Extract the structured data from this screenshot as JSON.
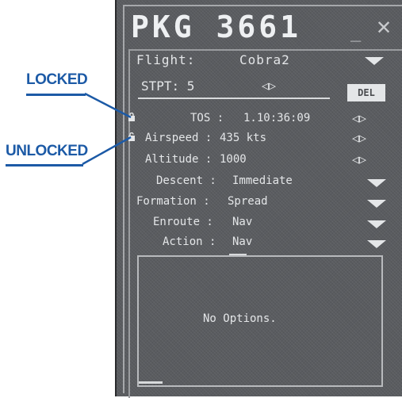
{
  "callouts": {
    "locked": "LOCKED",
    "unlocked": "UNLOCKED"
  },
  "window": {
    "title": "PKG 3661",
    "min": "_",
    "close": "✕"
  },
  "flight": {
    "label": "Flight:",
    "value": "Cobra2"
  },
  "stpt": {
    "label": "STPT: 5",
    "arrows": "◁▷",
    "del": "DEL"
  },
  "fields": [
    {
      "label": "TOS :",
      "value": "1.10:36:09",
      "control": "arrows"
    },
    {
      "label": "Airspeed :",
      "value": "435 kts",
      "control": "arrows"
    },
    {
      "label": "Altitude :",
      "value": "1000",
      "control": "arrows"
    },
    {
      "label": "Descent :",
      "value": "Immediate",
      "control": "dropdown"
    },
    {
      "label": "Formation :",
      "value": "Spread",
      "control": "dropdown"
    },
    {
      "label": "Enroute :",
      "value": "Nav",
      "control": "dropdown"
    },
    {
      "label": "Action :",
      "value": "Nav",
      "control": "dropdown"
    }
  ],
  "options": {
    "empty_text": "No Options."
  },
  "colors": {
    "callout": "#1c5aa6",
    "window_bg": "#5a5c60",
    "text": "#e4e6e8"
  }
}
